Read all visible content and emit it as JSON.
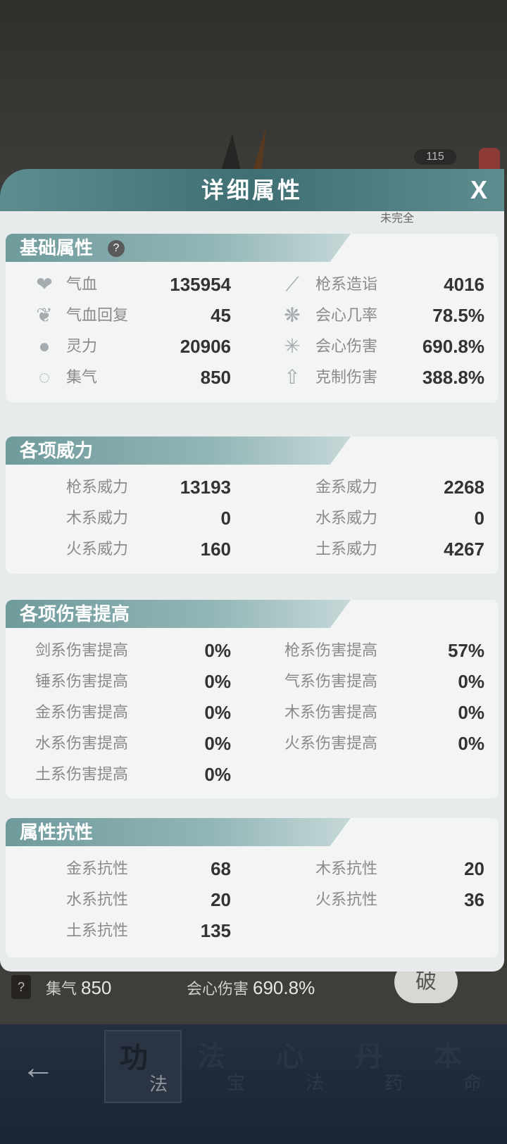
{
  "background": {
    "badge_number": "115",
    "strip": {
      "left_label": "集气",
      "left_value": "850",
      "right_label": "会心伤害",
      "right_value": "690.8%",
      "ring_text": "破"
    }
  },
  "modal": {
    "title": "详细属性",
    "close_label": "X",
    "stub_text": "未完全"
  },
  "sections": {
    "basic": {
      "title": "基础属性",
      "help_label": "?",
      "left": [
        {
          "icon": "heart-icon",
          "label": "气血",
          "value": "135954"
        },
        {
          "icon": "heal-icon",
          "label": "气血回复",
          "value": "45"
        },
        {
          "icon": "drop-icon",
          "label": "灵力",
          "value": "20906"
        },
        {
          "icon": "swirl-icon",
          "label": "集气",
          "value": "850"
        }
      ],
      "right": [
        {
          "icon": "spear-icon",
          "label": "枪系造诣",
          "value": "4016"
        },
        {
          "icon": "crit-chance-icon",
          "label": "会心几率",
          "value": "78.5%"
        },
        {
          "icon": "crit-damage-icon",
          "label": "会心伤害",
          "value": "690.8%"
        },
        {
          "icon": "counter-icon",
          "label": "克制伤害",
          "value": "388.8%"
        }
      ]
    },
    "power": {
      "title": "各项威力",
      "left": [
        {
          "label": "枪系威力",
          "value": "13193"
        },
        {
          "label": "木系威力",
          "value": "0"
        },
        {
          "label": "火系威力",
          "value": "160"
        }
      ],
      "right": [
        {
          "label": "金系威力",
          "value": "2268"
        },
        {
          "label": "水系威力",
          "value": "0"
        },
        {
          "label": "土系威力",
          "value": "4267"
        }
      ]
    },
    "damage": {
      "title": "各项伤害提高",
      "left": [
        {
          "label": "剑系伤害提高",
          "value": "0%"
        },
        {
          "label": "锤系伤害提高",
          "value": "0%"
        },
        {
          "label": "金系伤害提高",
          "value": "0%"
        },
        {
          "label": "水系伤害提高",
          "value": "0%"
        },
        {
          "label": "土系伤害提高",
          "value": "0%"
        }
      ],
      "right": [
        {
          "label": "枪系伤害提高",
          "value": "57%"
        },
        {
          "label": "气系伤害提高",
          "value": "0%"
        },
        {
          "label": "木系伤害提高",
          "value": "0%"
        },
        {
          "label": "火系伤害提高",
          "value": "0%"
        }
      ]
    },
    "resist": {
      "title": "属性抗性",
      "left": [
        {
          "label": "金系抗性",
          "value": "68"
        },
        {
          "label": "水系抗性",
          "value": "20"
        },
        {
          "label": "土系抗性",
          "value": "135"
        }
      ],
      "right": [
        {
          "label": "木系抗性",
          "value": "20"
        },
        {
          "label": "火系抗性",
          "value": "36"
        }
      ]
    }
  },
  "bottom_nav": {
    "back_label": "←",
    "tabs": [
      {
        "big": "功",
        "small": "法"
      },
      {
        "big": "法",
        "small": "宝"
      },
      {
        "big": "心",
        "small": "法"
      },
      {
        "big": "丹",
        "small": "药"
      },
      {
        "big": "本",
        "small": "命"
      }
    ]
  }
}
